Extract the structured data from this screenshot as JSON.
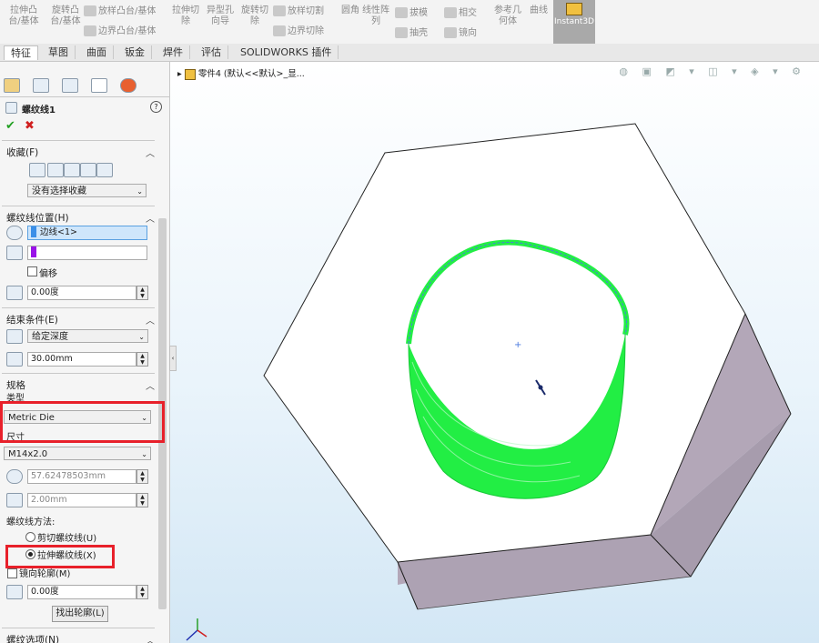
{
  "ribbon": {
    "items": [
      {
        "label": "拉伸凸\n台/基体"
      },
      {
        "label": "旋转凸\n台/基体"
      },
      {
        "label": "放样凸台/基体"
      },
      {
        "label": "边界凸台/基体"
      },
      {
        "label": "拉伸切\n除"
      },
      {
        "label": "异型孔\n向导"
      },
      {
        "label": "旋转切\n除"
      },
      {
        "label": "放样切割"
      },
      {
        "label": "边界切除"
      },
      {
        "label": "圆角"
      },
      {
        "label": "线性阵\n列"
      },
      {
        "label": "拔模"
      },
      {
        "label": "相交"
      },
      {
        "label": "抽壳"
      },
      {
        "label": "镜向"
      },
      {
        "label": "参考几\n何体"
      },
      {
        "label": "曲线"
      }
    ],
    "instant3d": "Instant3D"
  },
  "tabs": [
    "特征",
    "草图",
    "曲面",
    "钣金",
    "焊件",
    "评估",
    "SOLIDWORKS 插件"
  ],
  "panel": {
    "feature_name": "螺纹线1",
    "favorites": {
      "title": "收藏(F)",
      "select_value": "没有选择收藏"
    },
    "position": {
      "title": "螺纹线位置(H)",
      "edge_value": "边线<1>",
      "offset_label": "偏移",
      "angle_value": "0.00度"
    },
    "end": {
      "title": "结束条件(E)",
      "type_value": "给定深度",
      "depth_value": "30.00mm"
    },
    "spec": {
      "title": "规格",
      "type_label": "类型",
      "type_value": "Metric Die",
      "size_label": "尺寸",
      "size_value": "M14x2.0",
      "diameter_value": "57.62478503mm",
      "pitch_value": "2.00mm",
      "method_label": "螺纹线方法:",
      "method_cut": "剪切螺纹线(U)",
      "method_extrude": "拉伸螺纹线(X)",
      "flip_label": "镜向轮廓(M)",
      "angle_value": "0.00度",
      "locate_button": "找出轮廓(L)"
    },
    "options_title": "螺纹选项(N)"
  },
  "viewport": {
    "title": "零件4  (默认<<默认>_显..."
  },
  "colors": {
    "thread": "#22ee44",
    "highlight": "#e8202a",
    "face_top": "#ffffff",
    "face_side": "#b3a7b8"
  }
}
